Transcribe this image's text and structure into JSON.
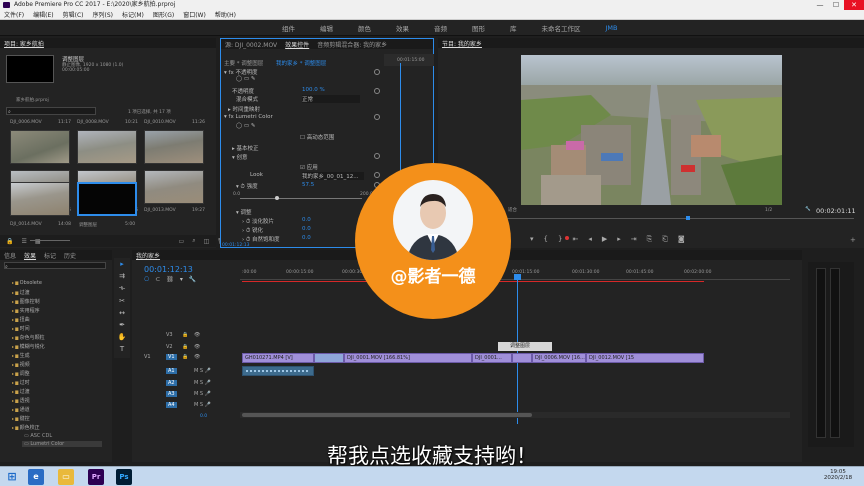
{
  "window": {
    "title": "Adobe Premiere Pro CC 2017 - E:\\2020\\家乡航拍.prproj",
    "min": "—",
    "max": "☐",
    "close": "✕"
  },
  "menu": [
    "文件(F)",
    "编辑(E)",
    "剪辑(C)",
    "序列(S)",
    "标记(M)",
    "图形(G)",
    "窗口(W)",
    "帮助(H)"
  ],
  "workspaces": [
    "组件",
    "编辑",
    "颜色",
    "效果",
    "音频",
    "图形",
    "库",
    "未命名工作区",
    "JMB"
  ],
  "project": {
    "tab": "项目: 家乡航拍",
    "title": "调整图层",
    "info1": "静止图像, 1920 x 1080 (1.0)",
    "info2": "00:00:05:00",
    "file": "家乡航拍.prproj",
    "selected": "1 项已选择, 共 17 项",
    "thumbs": [
      {
        "name": "DJI_0006.MOV",
        "dur": "11:17"
      },
      {
        "name": "DJI_0008.MOV",
        "dur": "10:21"
      },
      {
        "name": "DJI_0010.MOV",
        "dur": "11:26"
      },
      {
        "name": "DJI_0011.MOV",
        "dur": "49:06"
      },
      {
        "name": "DJI_0011.MOV",
        "dur": "16:26"
      },
      {
        "name": "DJI_0013.MOV",
        "dur": "19:27"
      },
      {
        "name": "DJI_0014.MOV",
        "dur": "14:08"
      },
      {
        "name": "调整图层",
        "dur": "5:00"
      }
    ]
  },
  "effect_controls": {
    "tabs": [
      "源: DJI_0002.MOV",
      "效果控件",
      "音频剪辑混合器: 我的家乡"
    ],
    "master": "主要 * 调整图层",
    "seq": "我的家乡 * 调整图层",
    "rows": {
      "opacity": "不透明度",
      "opacity_label": "不透明度",
      "opacity_val": "100.0 %",
      "blend": "混合模式",
      "blend_val": "正常",
      "remap": "时间重映射",
      "lumetri": "Lumetri Color",
      "hq": "高动态范围",
      "basic": "基本校正",
      "creative": "创意",
      "apply": "应用",
      "look": "Look",
      "look_val": "我的家乡_00_01_12...",
      "intensity": "强度",
      "intensity_val": "57.5",
      "adjust": "调整",
      "faded": "淡化胶片",
      "faded_val": "0.0",
      "sharpen": "锐化",
      "sharpen_val": "0.0",
      "vibrance": "自然饱和度",
      "vibrance_val": "0.0",
      "scale_min": "0.0",
      "scale_max": "200.0"
    },
    "timecode": "00:01:12:13",
    "time_top": "00:01:15:00"
  },
  "program": {
    "tab": "节目: 我的家乡",
    "timecode_left": "00:01:12:13",
    "fit": "适合",
    "quality": "1/2",
    "timecode_right": "00:02:01:11"
  },
  "effects_panel": {
    "tabs": [
      "信息",
      "效果",
      "标记",
      "历史"
    ],
    "items": [
      "Obsolete",
      "过渡",
      "图像控制",
      "实用程序",
      "扭曲",
      "时间",
      "杂色与颗粒",
      "模糊与锐化",
      "生成",
      "视频",
      "调整",
      "过时",
      "过渡",
      "透视",
      "通道",
      "键控",
      "颜色校正"
    ],
    "leaf1": "ASC CDL",
    "leaf2": "Lumetri Color"
  },
  "timeline": {
    "tab": "我的家乡",
    "timecode": "00:01:12:13",
    "ticks": [
      ":00:00",
      "00:00:15:00",
      "00:00:30:00",
      "00:00:45:00",
      "00:01:00:00",
      "00:01:15:00",
      "00:01:30:00",
      "00:01:45:00",
      "00:02:00:00"
    ],
    "tracks_v": [
      "V3",
      "V2",
      "V1"
    ],
    "tracks_a": [
      "A1",
      "A2",
      "A3",
      "A4"
    ],
    "master_val": "0.0",
    "label_adj": "调整图层",
    "clips": [
      "GH010271.MP4 [V]",
      "DJI_0001.MOV [166.81%]",
      "DJI_0001...",
      "DJI_0006.MOV [16...",
      "DJI_0012.MOV [15"
    ]
  },
  "watermark": "@影者一德",
  "subtitle": "帮我点选收藏支持哟！",
  "taskbar": {
    "time": "19:05",
    "date": "2020/2/18",
    "pr": "Pr",
    "ps": "Ps"
  }
}
